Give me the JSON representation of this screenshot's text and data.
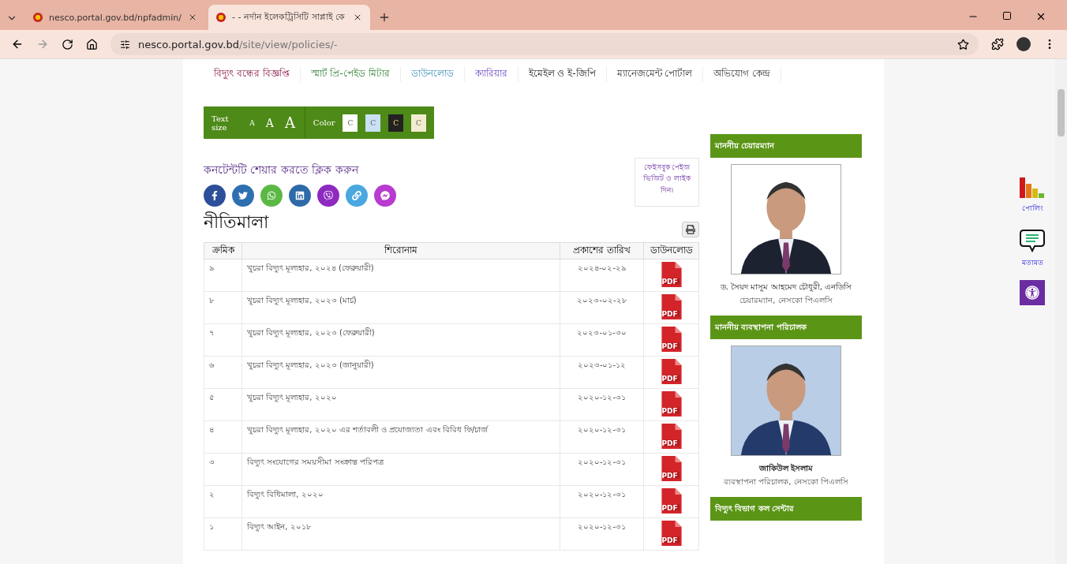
{
  "browser": {
    "tabs": [
      {
        "title": "nesco.portal.gov.bd/npfadmin/",
        "selected": false
      },
      {
        "title": "- - নর্দান ইলেকট্রিসিটি সাপ্লাই কে",
        "selected": true
      }
    ],
    "address": {
      "host": "nesco.portal.gov.bd",
      "path": "/site/view/policies/-"
    }
  },
  "nav": [
    {
      "label": "বিদ্যুৎ বন্ধের বিজ্ঞপ্তি"
    },
    {
      "label": "স্মার্ট প্রি-পেইড মিটার"
    },
    {
      "label": "ডাউনলোড"
    },
    {
      "label": "ক্যারিয়ার"
    },
    {
      "label": "ইমেইল ও ই-জিপি"
    },
    {
      "label": "ম্যানেজমেন্ট পোর্টাল"
    },
    {
      "label": "অভিযোগ কেন্দ্র"
    }
  ],
  "accessibility": {
    "text_size_label": "Text size",
    "sizes": [
      "A",
      "A",
      "A"
    ],
    "color_label": "Color",
    "swatches": [
      {
        "label": "C",
        "color": "#ffffff"
      },
      {
        "label": "C",
        "color": "#c9e0f7"
      },
      {
        "label": "C",
        "color": "#222222"
      },
      {
        "label": "C",
        "color": "#f3ecd0"
      }
    ]
  },
  "share": {
    "title": "কনটেন্টটি শেয়ার করতে ক্লিক করুন",
    "buttons": [
      {
        "kind": "facebook",
        "color": "#2d4f9a"
      },
      {
        "kind": "twitter",
        "color": "#2e6fb0"
      },
      {
        "kind": "whatsapp",
        "color": "#5cb845"
      },
      {
        "kind": "linkedin",
        "color": "#2e6aa7"
      },
      {
        "kind": "viber",
        "color": "#8e2ac0"
      },
      {
        "kind": "link",
        "color": "#4aa7e0"
      },
      {
        "kind": "messenger",
        "color": "#b83ad0"
      }
    ]
  },
  "facebook_note": "ফেইসবুক পেইজ ভিজিট ও লাইক দিন।",
  "page_title": "নীতিমালা",
  "table": {
    "columns": [
      "ক্রমিক",
      "শিরোনাম",
      "প্রকাশের তারিখ",
      "ডাউনলোড"
    ],
    "rows": [
      {
        "serial": "৯",
        "title": "খুচরা বিদ্যুৎ মূল্যহার, ২০২৪ (ফেব্রুয়ারী)",
        "date": "২০২৪-০২-২৯",
        "file": "PDF"
      },
      {
        "serial": "৮",
        "title": "খুচরা বিদ্যুৎ মূল্যহার, ২০২৩ (মার্চ)",
        "date": "২০২৩-০২-২৮",
        "file": "PDF"
      },
      {
        "serial": "৭",
        "title": "খুচরা বিদ্যুৎ মূল্যহার, ২০২৩ (ফেব্রুয়ারী)",
        "date": "২০২৩-০১-৩০",
        "file": "PDF"
      },
      {
        "serial": "৬",
        "title": "খুচরা বিদ্যুৎ মূল্যহার, ২০২৩ (জানুয়ারী)",
        "date": "২০২৩-০১-১২",
        "file": "PDF"
      },
      {
        "serial": "৫",
        "title": "খুচরা বিদ্যুৎ মূল্যহার, ২০২০",
        "date": "২০২০-১২-৩১",
        "file": "PDF"
      },
      {
        "serial": "৪",
        "title": "খুচরা বিদ্যুৎ মূল্যহার, ২০২০ এর শর্তাবলী ও প্রযোজ্যতা এবং বিবিধ ফি/চার্জ",
        "date": "২০২০-১২-৩১",
        "file": "PDF"
      },
      {
        "serial": "৩",
        "title": "বিদ্যুৎ সংযোগের সময়সীমা সংক্রান্ত পরিপত্র",
        "date": "২০২০-১২-৩১",
        "file": "PDF"
      },
      {
        "serial": "২",
        "title": "বিদ্যুৎ বিধিমালা, ২০২০",
        "date": "২০২০-১২-৩১",
        "file": "PDF"
      },
      {
        "serial": "১",
        "title": "বিদ্যুৎ আইন, ২০১৮",
        "date": "২০২০-১২-৩১",
        "file": "PDF"
      }
    ]
  },
  "sidebar": [
    {
      "heading": "মাননীয় চেয়ারম্যান",
      "name": "ড. সৈয়দ মাসুম আহমেদ চৌধুরী, এনডিসি",
      "role": "চেয়ারম্যান, নেসকো পিএলসি"
    },
    {
      "heading": "মাননীয় ব্যবস্থাপনা পরিচালক",
      "name": "জাকিউল ইসলাম",
      "role": "ব্যবস্থাপনা পরিচালক, নেসকো পিএলসি"
    },
    {
      "heading": "বিদ্যুৎ বিভাগ কল সেন্টার"
    }
  ],
  "widgets": [
    {
      "kind": "poll",
      "label": "পোলিং"
    },
    {
      "kind": "feedback",
      "label": "মতামত"
    },
    {
      "kind": "accessibility"
    }
  ]
}
